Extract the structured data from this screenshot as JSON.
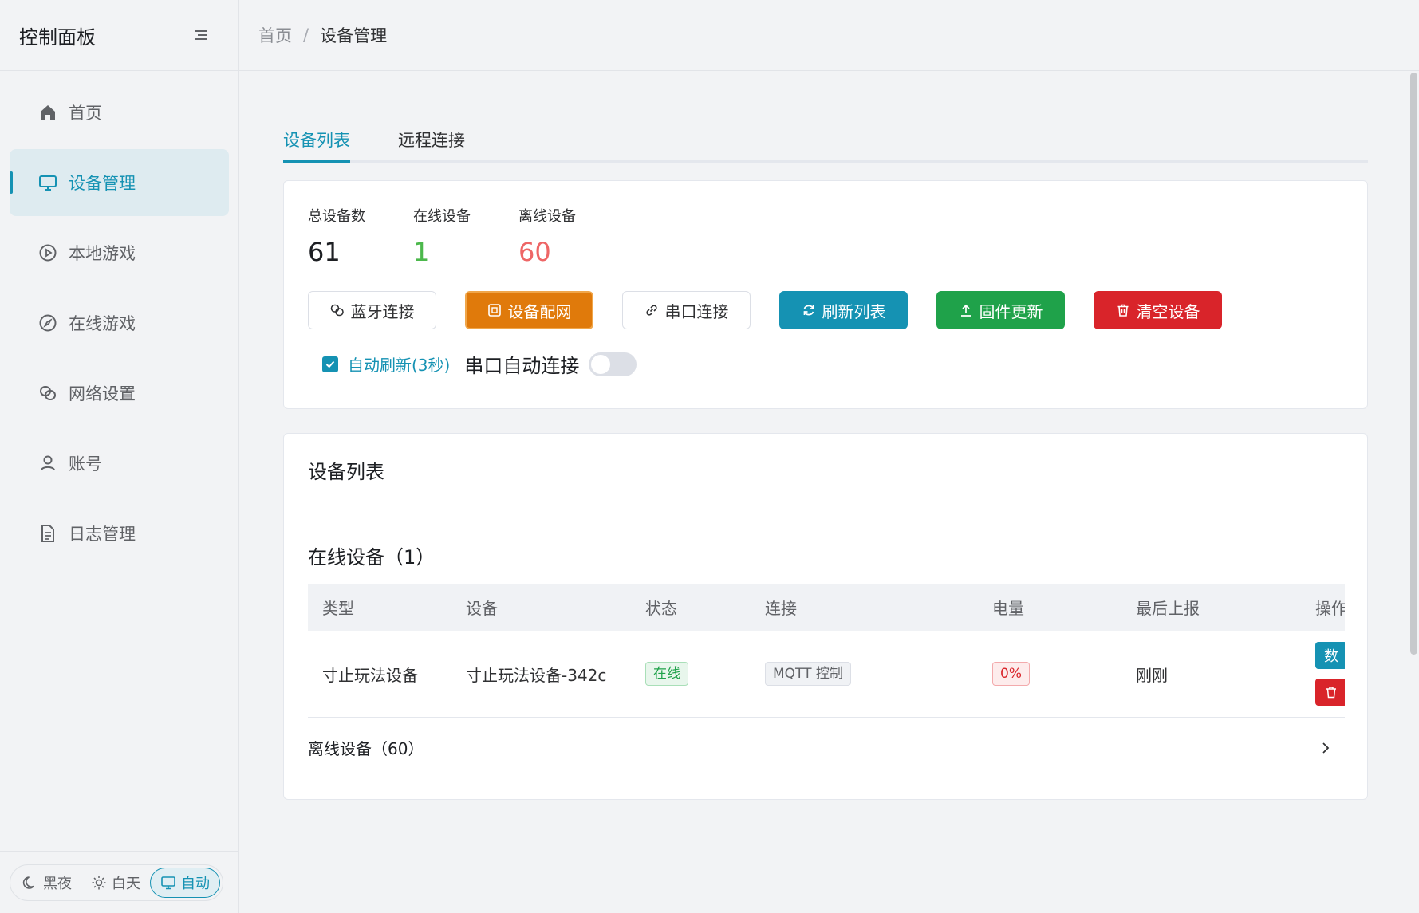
{
  "sidebar": {
    "title": "控制面板",
    "items": [
      {
        "label": "首页",
        "icon": "home-icon"
      },
      {
        "label": "设备管理",
        "icon": "monitor-icon",
        "active": true
      },
      {
        "label": "本地游戏",
        "icon": "play-circle-icon"
      },
      {
        "label": "在线游戏",
        "icon": "compass-icon"
      },
      {
        "label": "网络设置",
        "icon": "link-circles-icon"
      },
      {
        "label": "账号",
        "icon": "user-icon"
      },
      {
        "label": "日志管理",
        "icon": "document-icon"
      }
    ],
    "theme": {
      "dark": "黑夜",
      "light": "白天",
      "auto": "自动",
      "selected": "自动"
    }
  },
  "breadcrumb": {
    "home": "首页",
    "separator": "/",
    "current": "设备管理"
  },
  "tabs": [
    {
      "label": "设备列表",
      "active": true
    },
    {
      "label": "远程连接",
      "active": false
    }
  ],
  "stats": {
    "total_label": "总设备数",
    "total": "61",
    "online_label": "在线设备",
    "online": "1",
    "offline_label": "离线设备",
    "offline": "60"
  },
  "buttons": {
    "bluetooth": "蓝牙连接",
    "provision": "设备配网",
    "serial": "串口连接",
    "refresh": "刷新列表",
    "firmware": "固件更新",
    "clear": "清空设备"
  },
  "options": {
    "auto_refresh": "自动刷新(3秒)",
    "auto_refresh_checked": true,
    "serial_auto": "串口自动连接",
    "serial_auto_on": false
  },
  "device_list": {
    "title": "设备列表",
    "online_section": "在线设备（1）",
    "columns": [
      "类型",
      "设备",
      "状态",
      "连接",
      "电量",
      "最后上报",
      "操作"
    ],
    "rows": [
      {
        "type": "寸止玩法设备",
        "device": "寸止玩法设备-342c",
        "status": "在线",
        "connection": "MQTT 控制",
        "battery": "0%",
        "last_report": "刚刚",
        "op_primary": "数"
      }
    ],
    "offline_section": "离线设备（60）"
  },
  "colors": {
    "accent": "#1592b3",
    "online": "#4cb84c",
    "offline": "#ee6666",
    "orange": "#e07a0b",
    "green": "#1fa24a",
    "red": "#d9242a"
  }
}
